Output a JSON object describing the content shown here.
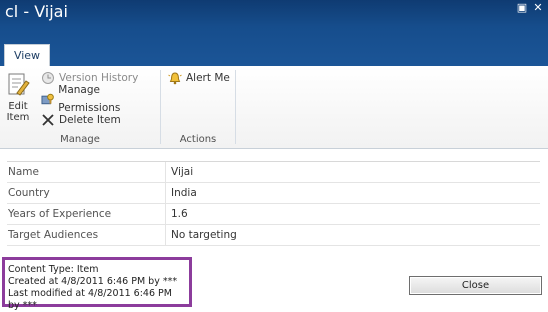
{
  "window": {
    "title": "cl - Vijai",
    "maximize_glyph": "▣",
    "close_glyph": "✕"
  },
  "ribbon": {
    "tab_label": "View",
    "manage": {
      "edit_item_label_line1": "Edit",
      "edit_item_label_line2": "Item",
      "version_history_label": "Version History",
      "manage_permissions_label": "Manage Permissions",
      "delete_item_label": "Delete Item",
      "group_label": "Manage"
    },
    "actions": {
      "alert_me_label": "Alert Me",
      "group_label": "Actions"
    }
  },
  "fields": [
    {
      "label": "Name",
      "value": "Vijai"
    },
    {
      "label": "Country",
      "value": "India"
    },
    {
      "label": "Years of Experience",
      "value": "1.6"
    },
    {
      "label": "Target Audiences",
      "value": "No targeting"
    }
  ],
  "meta": {
    "content_type": "Content Type: Item",
    "created": "Created at 4/8/2011 6:46 PM by ***",
    "modified": "Last modified at 4/8/2011 6:46 PM by ***"
  },
  "close_button_label": "Close",
  "colors": {
    "titlebar": "#164d8c",
    "highlight_border": "#8c3c9c"
  }
}
